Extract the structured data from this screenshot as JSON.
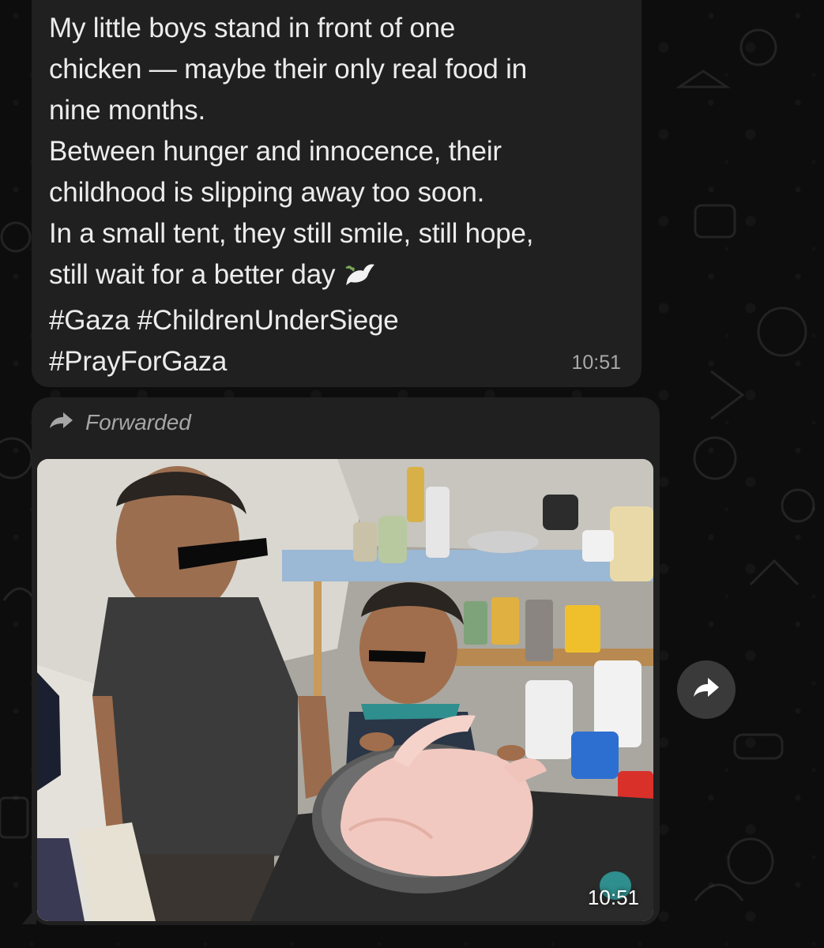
{
  "message_text": {
    "lines": [
      "My little boys stand in front of one",
      "chicken — maybe their only real food in",
      "nine months.",
      "Between hunger and innocence, their",
      "childhood is slipping away too soon.",
      "In a small tent, they still smile, still hope,",
      "still wait for a better day",
      "#Gaza #ChildrenUnderSiege",
      "#PrayForGaza"
    ],
    "emoji_icon": "dove-with-olive-branch-icon",
    "time": "10:51"
  },
  "message_media": {
    "forwarded_label": "Forwarded",
    "forwarded_icon": "forward-arrow-icon",
    "photo_description_icon": "photo-two-boys-with-raw-chicken",
    "time": "10:51"
  },
  "share_button": {
    "icon": "forward-arrow-icon"
  },
  "colors": {
    "background": "#0d0d0d",
    "bubble": "#202020",
    "text": "#ececec",
    "timestamp": "#a9a9a9"
  }
}
